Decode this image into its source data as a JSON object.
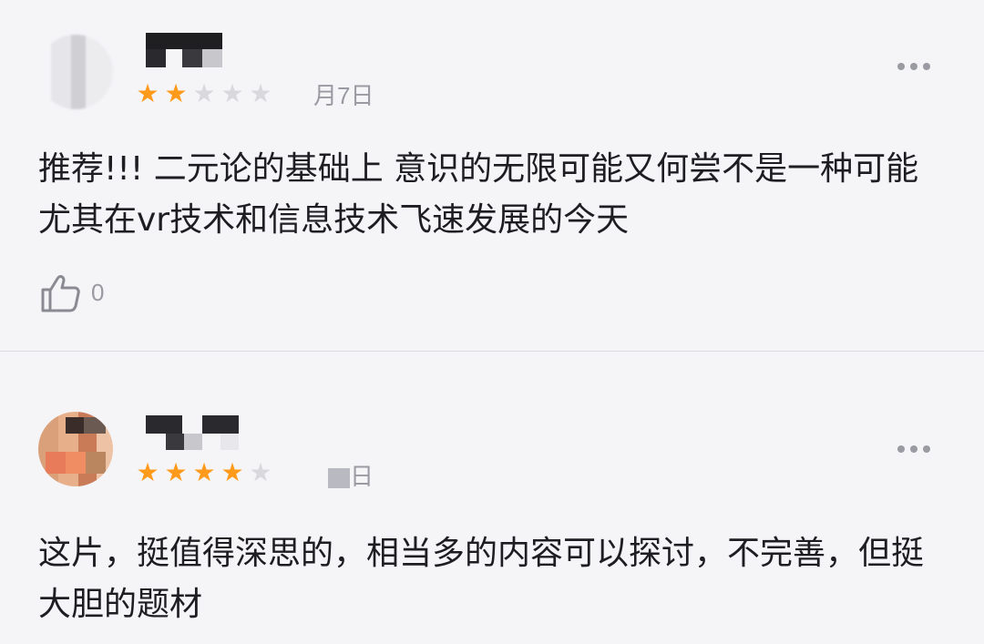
{
  "comments": [
    {
      "rating": 2,
      "max_rating": 5,
      "date": "月7日",
      "text": "推荐!!! 二元论的基础上 意识的无限可能又何尝不是一种可能 尤其在vr技术和信息技术飞速发展的今天",
      "likes": "0"
    },
    {
      "rating": 4,
      "max_rating": 5,
      "date": "日",
      "text": "这片，挺值得深思的，相当多的内容可以探讨，不完善，但挺大胆的题材"
    }
  ],
  "icons": {
    "like": "thumbs-up-icon",
    "more": "more-options-icon",
    "star": "star-icon"
  },
  "colors": {
    "star_active": "#ff9a1a",
    "star_inactive": "#d9d9dd",
    "text": "#1e1e22",
    "meta": "#9a9aa2",
    "background": "#f5f5f8"
  }
}
